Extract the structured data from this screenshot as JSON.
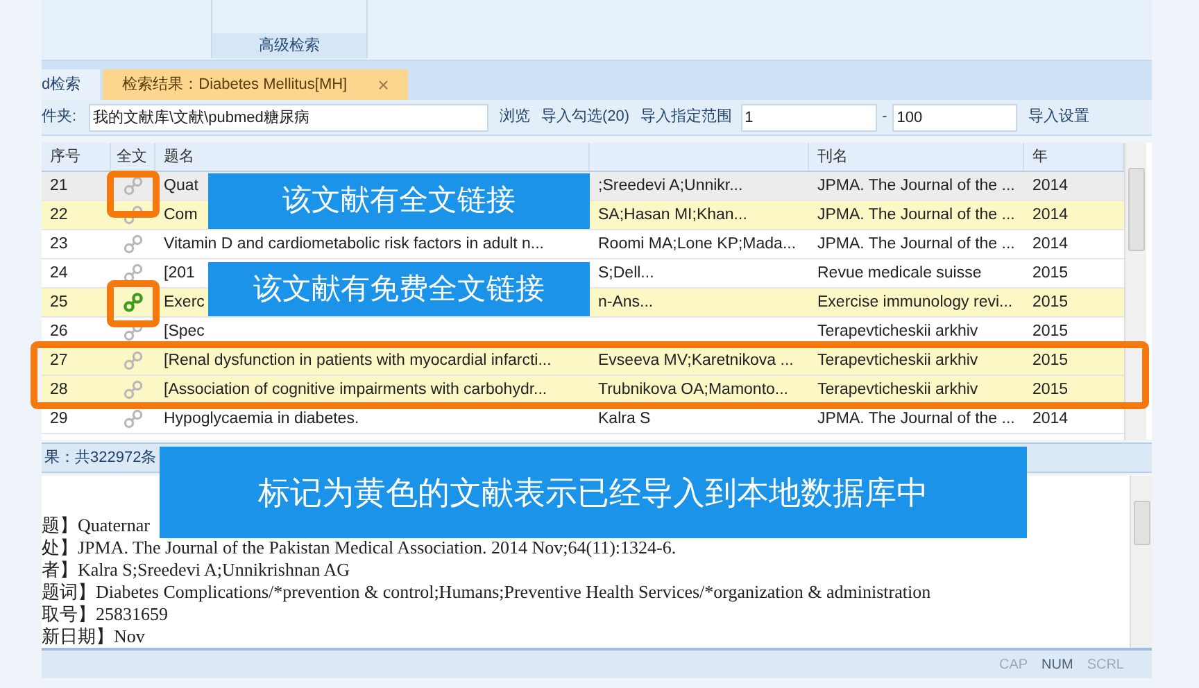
{
  "ribbon": {
    "group_label": "高级检索"
  },
  "tabs": [
    {
      "label": "d检索",
      "selected": false
    },
    {
      "label": "检索结果：Diabetes Mellitus[MH]",
      "selected": true,
      "close": "×"
    }
  ],
  "toolbar": {
    "folder_label": "件夹:",
    "folder_value": "我的文献库\\文献\\pubmed糖尿病",
    "browse": "浏览",
    "import_checked": "导入勾选(20)",
    "import_range": "导入指定范围",
    "range_from": "1",
    "range_sep": "-",
    "range_to": "100",
    "import_settings": "导入设置"
  },
  "table": {
    "columns": [
      "序号",
      "全文",
      "题名",
      "",
      "刊名",
      "年"
    ],
    "rows": [
      {
        "cells": [
          "21",
          "",
          "Quat",
          ";Sreedevi A;Unnikr...",
          "JPMA. The Journal of the ...",
          "2014"
        ],
        "selected": true,
        "imported": false,
        "free_fulltext": false
      },
      {
        "cells": [
          "22",
          "",
          "Com",
          "SA;Hasan MI;Khan...",
          "JPMA. The Journal of the ...",
          "2014"
        ],
        "selected": false,
        "imported": true,
        "free_fulltext": false
      },
      {
        "cells": [
          "23",
          "",
          "Vitamin D and cardiometabolic risk factors in adult n...",
          "Roomi MA;Lone KP;Mada...",
          "JPMA. The Journal of the ...",
          "2014"
        ],
        "selected": false,
        "imported": false,
        "free_fulltext": false
      },
      {
        "cells": [
          "24",
          "",
          "[201",
          "S;Dell...",
          "Revue medicale suisse",
          "2015"
        ],
        "selected": false,
        "imported": false,
        "free_fulltext": false
      },
      {
        "cells": [
          "25",
          "",
          "Exerc",
          "n-Ans...",
          "Exercise immunology revi...",
          "2015"
        ],
        "selected": false,
        "imported": true,
        "free_fulltext": true
      },
      {
        "cells": [
          "26",
          "",
          "[Spec",
          "",
          "Terapevticheskii arkhiv",
          "2015"
        ],
        "selected": false,
        "imported": false,
        "free_fulltext": false
      },
      {
        "cells": [
          "27",
          "",
          "[Renal dysfunction in patients with myocardial infarcti...",
          "Evseeva MV;Karetnikova ...",
          "Terapevticheskii arkhiv",
          "2015"
        ],
        "selected": false,
        "imported": true,
        "free_fulltext": false
      },
      {
        "cells": [
          "28",
          "",
          "[Association of cognitive impairments with carbohydr...",
          "Trubnikova OA;Mamonto...",
          "Terapevticheskii arkhiv",
          "2015"
        ],
        "selected": false,
        "imported": true,
        "free_fulltext": false
      },
      {
        "cells": [
          "29",
          "",
          "Hypoglycaemia in diabetes.",
          "Kalra S",
          "JPMA. The Journal of the ...",
          "2014"
        ],
        "selected": false,
        "imported": false,
        "free_fulltext": false
      }
    ]
  },
  "result_count": "果：共322972条",
  "detail_lines": [
    "题】Quaternar",
    "处】JPMA. The Journal of the Pakistan Medical Association. 2014 Nov;64(11):1324-6.",
    "者】Kalra S;Sreedevi A;Unnikrishnan AG",
    "题词】Diabetes Complications/*prevention & control;Humans;Preventive Health Services/*organization & administration",
    "取号】25831659",
    "新日期】Nov"
  ],
  "status_bar": [
    {
      "label": "CAP",
      "on": false
    },
    {
      "label": "NUM",
      "on": true
    },
    {
      "label": "SCRL",
      "on": false
    }
  ],
  "callouts": [
    "该文献有全文链接",
    "该文献有免费全文链接",
    "标记为黄色的文献表示已经导入到本地数据库中"
  ]
}
